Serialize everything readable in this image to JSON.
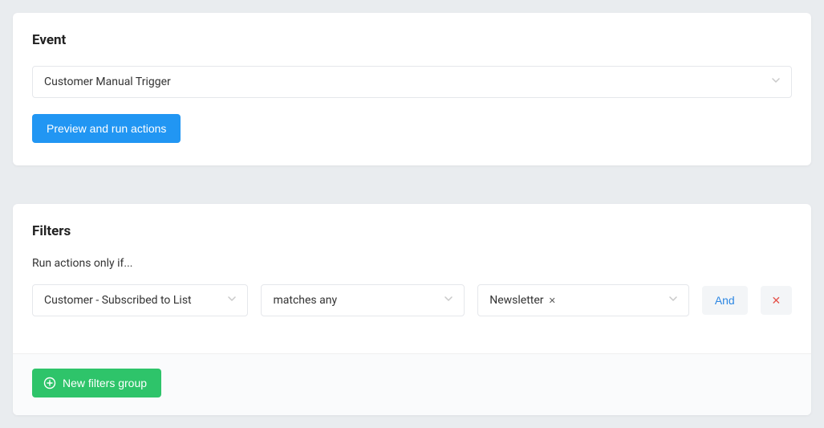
{
  "event": {
    "title": "Event",
    "select_value": "Customer Manual Trigger",
    "run_button_label": "Preview and run actions"
  },
  "filters": {
    "title": "Filters",
    "description": "Run actions only if...",
    "field_select_value": "Customer - Subscribed to List",
    "operator_select_value": "matches any",
    "tag_value": "Newsletter",
    "logic_label": "And",
    "new_group_label": "New filters group"
  }
}
